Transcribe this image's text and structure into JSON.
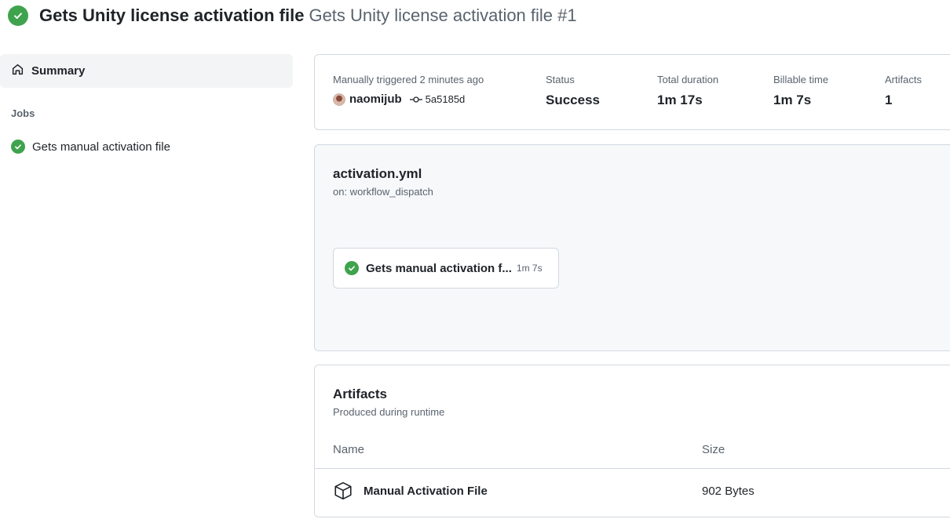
{
  "header": {
    "workflow_title": "Gets Unity license activation file",
    "run_title": "Gets Unity license activation file #1",
    "status_icon": "check-circle-icon"
  },
  "sidebar": {
    "summary_label": "Summary",
    "summary_icon": "home-icon",
    "jobs_heading": "Jobs",
    "jobs": [
      {
        "label": "Gets manual activation file",
        "status_icon": "check-circle-icon"
      }
    ]
  },
  "summary": {
    "trigger_label": "Manually triggered 2 minutes ago",
    "actor": "naomijub",
    "commit": "5a5185d",
    "status_label": "Status",
    "status_value": "Success",
    "duration_label": "Total duration",
    "duration_value": "1m 17s",
    "billable_label": "Billable time",
    "billable_value": "1m 7s",
    "artifacts_label": "Artifacts",
    "artifacts_value": "1"
  },
  "workflow": {
    "file": "activation.yml",
    "trigger": "on: workflow_dispatch",
    "job_name": "Gets manual activation f...",
    "job_duration": "1m 7s"
  },
  "artifacts": {
    "title": "Artifacts",
    "subtitle": "Produced during runtime",
    "col_name": "Name",
    "col_size": "Size",
    "items": [
      {
        "name": "Manual Activation File",
        "size": "902 Bytes",
        "icon": "package-icon"
      }
    ]
  },
  "colors": {
    "success": "#3fa34d",
    "muted_text": "#59636e",
    "border": "#d1d9e0",
    "sidebar_selected_bg": "#f3f4f6",
    "graph_bg": "#f6f8fa"
  }
}
